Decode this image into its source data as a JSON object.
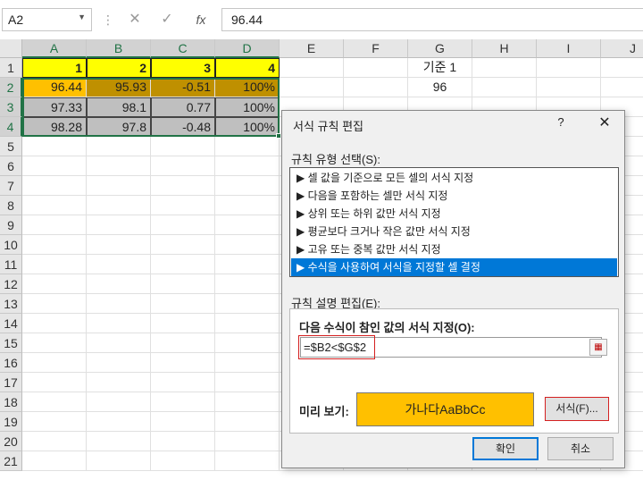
{
  "formula_bar": {
    "name_box": "A2",
    "formula": "96.44",
    "fx_label": "fx"
  },
  "columns": [
    "A",
    "B",
    "C",
    "D",
    "E",
    "F",
    "G",
    "H",
    "I",
    "J"
  ],
  "rows": [
    "1",
    "2",
    "3",
    "4",
    "5",
    "6",
    "7",
    "8",
    "9",
    "10",
    "11",
    "12",
    "13",
    "14",
    "15",
    "16",
    "17",
    "18",
    "19",
    "20",
    "21"
  ],
  "cells": {
    "A1": "1",
    "B1": "2",
    "C1": "3",
    "D1": "4",
    "A2": "96.44",
    "B2": "95.93",
    "C2": "-0.51",
    "D2": "100%",
    "A3": "97.33",
    "B3": "98.1",
    "C3": "0.77",
    "D3": "100%",
    "A4": "98.28",
    "B4": "97.8",
    "C4": "-0.48",
    "D4": "100%",
    "G1": "기준 1",
    "G2": "96"
  },
  "colors": {
    "header_yellow": "#ffff00",
    "highlight_orange": "#ffc000",
    "highlight_dark": "#bf9000",
    "gray_fill": "#bfbfbf",
    "selection_green": "#217346",
    "list_selected": "#0078d7"
  },
  "dialog": {
    "title": "서식 규칙 편집",
    "help": "?",
    "close": "✕",
    "rule_type_label": "규칙 유형 선택(S):",
    "rule_types": [
      "▶ 셀 값을 기준으로 모든 셀의 서식 지정",
      "▶ 다음을 포함하는 셀만 서식 지정",
      "▶ 상위 또는 하위 값만 서식 지정",
      "▶ 평균보다 크거나 작은 값만 서식 지정",
      "▶ 고유 또는 중복 값만 서식 지정",
      "▶ 수식을 사용하여 서식을 지정할 셀 결정"
    ],
    "selected_rule_index": 5,
    "edit_label": "규칙 설명 편집(E):",
    "formula_caption": "다음 수식이 참인 값의 서식 지정(O):",
    "formula_value": "=$B2<$G$2",
    "preview_label": "미리 보기:",
    "preview_text": "가나다AaBbCc",
    "format_button": "서식(F)...",
    "ok_button": "확인",
    "cancel_button": "취소"
  }
}
